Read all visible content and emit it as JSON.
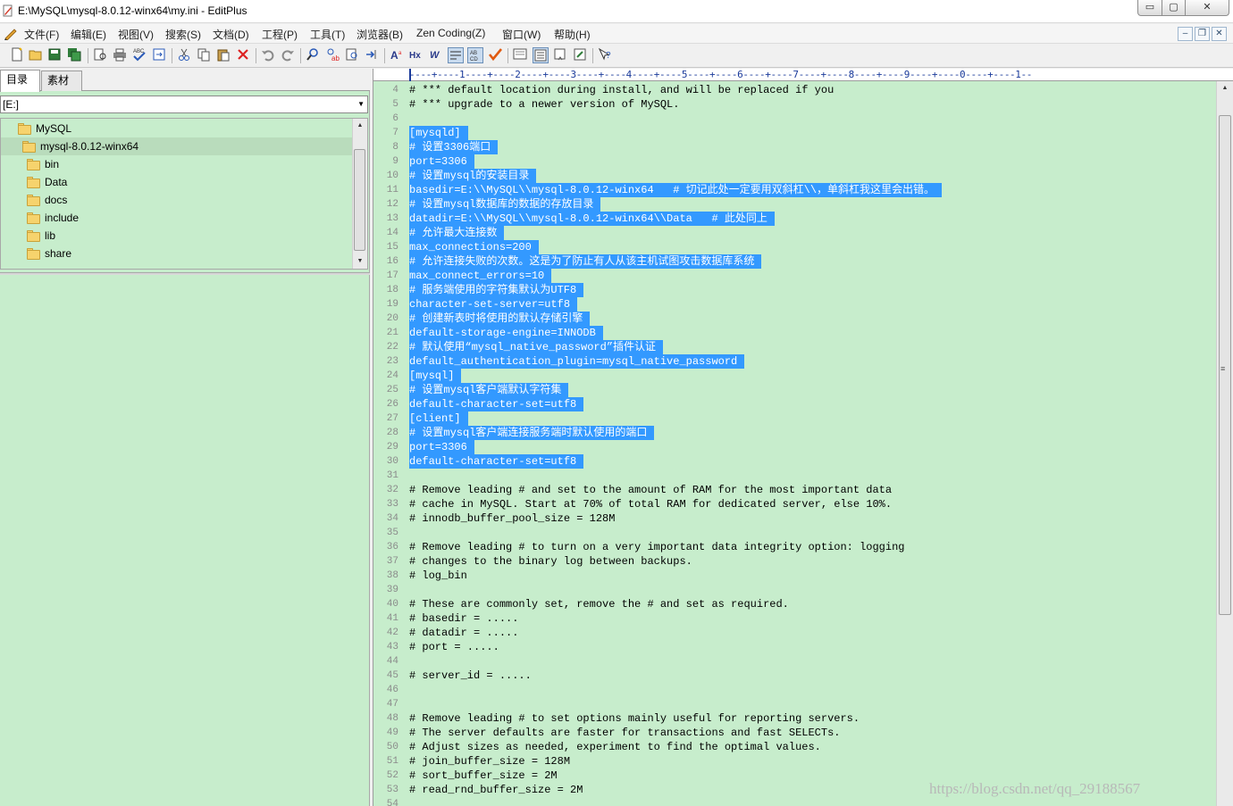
{
  "window": {
    "title": "E:\\MySQL\\mysql-8.0.12-winx64\\my.ini - EditPlus",
    "min_label": "▭",
    "max_label": "▢",
    "close_label": "✕"
  },
  "menu": {
    "items": [
      "文件(F)",
      "编辑(E)",
      "视图(V)",
      "搜索(S)",
      "文档(D)",
      "工程(P)",
      "工具(T)",
      "浏览器(B)",
      "Zen Coding(Z)",
      "窗口(W)",
      "帮助(H)"
    ],
    "mdi_min": "–",
    "mdi_restore": "❐",
    "mdi_close": "✕"
  },
  "toolbar": {
    "icons": [
      "new-file-icon",
      "open-folder-icon",
      "save-icon",
      "save-all-icon",
      "print-preview-icon",
      "print-icon",
      "spell-check-icon",
      "sync-icon",
      "cut-icon",
      "copy-icon",
      "paste-icon",
      "delete-icon",
      "undo-icon",
      "redo-icon",
      "find-icon",
      "replace-icon",
      "find-in-files-icon",
      "goto-icon",
      "font-icon",
      "heading-icon",
      "word-wrap-icon",
      "line-numbers-icon",
      "column-select-icon",
      "check-icon",
      "browser-preview-icon",
      "ruler-icon",
      "screen-icon",
      "split-icon",
      "help-icon"
    ]
  },
  "left_panel": {
    "tab_directory": "目录",
    "tab_material": "素材",
    "drive": "[E:]",
    "tree": [
      {
        "label": "MySQL",
        "level": 0
      },
      {
        "label": "mysql-8.0.12-winx64",
        "level": 1
      },
      {
        "label": "bin",
        "level": 2
      },
      {
        "label": "Data",
        "level": 2
      },
      {
        "label": "docs",
        "level": 2
      },
      {
        "label": "include",
        "level": 2
      },
      {
        "label": "lib",
        "level": 2
      },
      {
        "label": "share",
        "level": 2
      }
    ]
  },
  "editor": {
    "ruler": "----+----1----+----2----+----3----+----4----+----5----+----6----+----7----+----8----+----9----+----0----+----1--",
    "selected_from": 7,
    "selected_to": 30,
    "lines": [
      {
        "n": "4",
        "text": "# *** default location during install, and will be replaced if you"
      },
      {
        "n": "5",
        "text": "# *** upgrade to a newer version of MySQL."
      },
      {
        "n": "6",
        "text": ""
      },
      {
        "n": "7",
        "text": "[mysqld]"
      },
      {
        "n": "8",
        "text": "# 设置3306端口"
      },
      {
        "n": "9",
        "text": "port=3306"
      },
      {
        "n": "10",
        "text": "# 设置mysql的安装目录"
      },
      {
        "n": "11",
        "text": "basedir=E:\\\\MySQL\\\\mysql-8.0.12-winx64   # 切记此处一定要用双斜杠\\\\，单斜杠我这里会出错。"
      },
      {
        "n": "12",
        "text": "# 设置mysql数据库的数据的存放目录"
      },
      {
        "n": "13",
        "text": "datadir=E:\\\\MySQL\\\\mysql-8.0.12-winx64\\\\Data   # 此处同上"
      },
      {
        "n": "14",
        "text": "# 允许最大连接数"
      },
      {
        "n": "15",
        "text": "max_connections=200"
      },
      {
        "n": "16",
        "text": "# 允许连接失败的次数。这是为了防止有人从该主机试图攻击数据库系统"
      },
      {
        "n": "17",
        "text": "max_connect_errors=10"
      },
      {
        "n": "18",
        "text": "# 服务端使用的字符集默认为UTF8"
      },
      {
        "n": "19",
        "text": "character-set-server=utf8"
      },
      {
        "n": "20",
        "text": "# 创建新表时将使用的默认存储引擎"
      },
      {
        "n": "21",
        "text": "default-storage-engine=INNODB"
      },
      {
        "n": "22",
        "text": "# 默认使用“mysql_native_password”插件认证"
      },
      {
        "n": "23",
        "text": "default_authentication_plugin=mysql_native_password"
      },
      {
        "n": "24",
        "text": "[mysql]"
      },
      {
        "n": "25",
        "text": "# 设置mysql客户端默认字符集"
      },
      {
        "n": "26",
        "text": "default-character-set=utf8"
      },
      {
        "n": "27",
        "text": "[client]"
      },
      {
        "n": "28",
        "text": "# 设置mysql客户端连接服务端时默认使用的端口"
      },
      {
        "n": "29",
        "text": "port=3306"
      },
      {
        "n": "30",
        "text": "default-character-set=utf8"
      },
      {
        "n": "31",
        "text": ""
      },
      {
        "n": "32",
        "text": "# Remove leading # and set to the amount of RAM for the most important data"
      },
      {
        "n": "33",
        "text": "# cache in MySQL. Start at 70% of total RAM for dedicated server, else 10%."
      },
      {
        "n": "34",
        "text": "# innodb_buffer_pool_size = 128M"
      },
      {
        "n": "35",
        "text": ""
      },
      {
        "n": "36",
        "text": "# Remove leading # to turn on a very important data integrity option: logging"
      },
      {
        "n": "37",
        "text": "# changes to the binary log between backups."
      },
      {
        "n": "38",
        "text": "# log_bin"
      },
      {
        "n": "39",
        "text": ""
      },
      {
        "n": "40",
        "text": "# These are commonly set, remove the # and set as required."
      },
      {
        "n": "41",
        "text": "# basedir = ....."
      },
      {
        "n": "42",
        "text": "# datadir = ....."
      },
      {
        "n": "43",
        "text": "# port = ....."
      },
      {
        "n": "44",
        "text": ""
      },
      {
        "n": "45",
        "text": "# server_id = ....."
      },
      {
        "n": "46",
        "text": ""
      },
      {
        "n": "47",
        "text": ""
      },
      {
        "n": "48",
        "text": "# Remove leading # to set options mainly useful for reporting servers."
      },
      {
        "n": "49",
        "text": "# The server defaults are faster for transactions and fast SELECTs."
      },
      {
        "n": "50",
        "text": "# Adjust sizes as needed, experiment to find the optimal values."
      },
      {
        "n": "51",
        "text": "# join_buffer_size = 128M"
      },
      {
        "n": "52",
        "text": "# sort_buffer_size = 2M"
      },
      {
        "n": "53",
        "text": "# read_rnd_buffer_size = 2M"
      },
      {
        "n": "54",
        "text": ""
      }
    ]
  },
  "watermark": "https://blog.csdn.net/qq_29188567",
  "colors": {
    "editor_bg": "#c7edcc",
    "selection": "#3399ff",
    "line_number": "#8a8a8a"
  }
}
